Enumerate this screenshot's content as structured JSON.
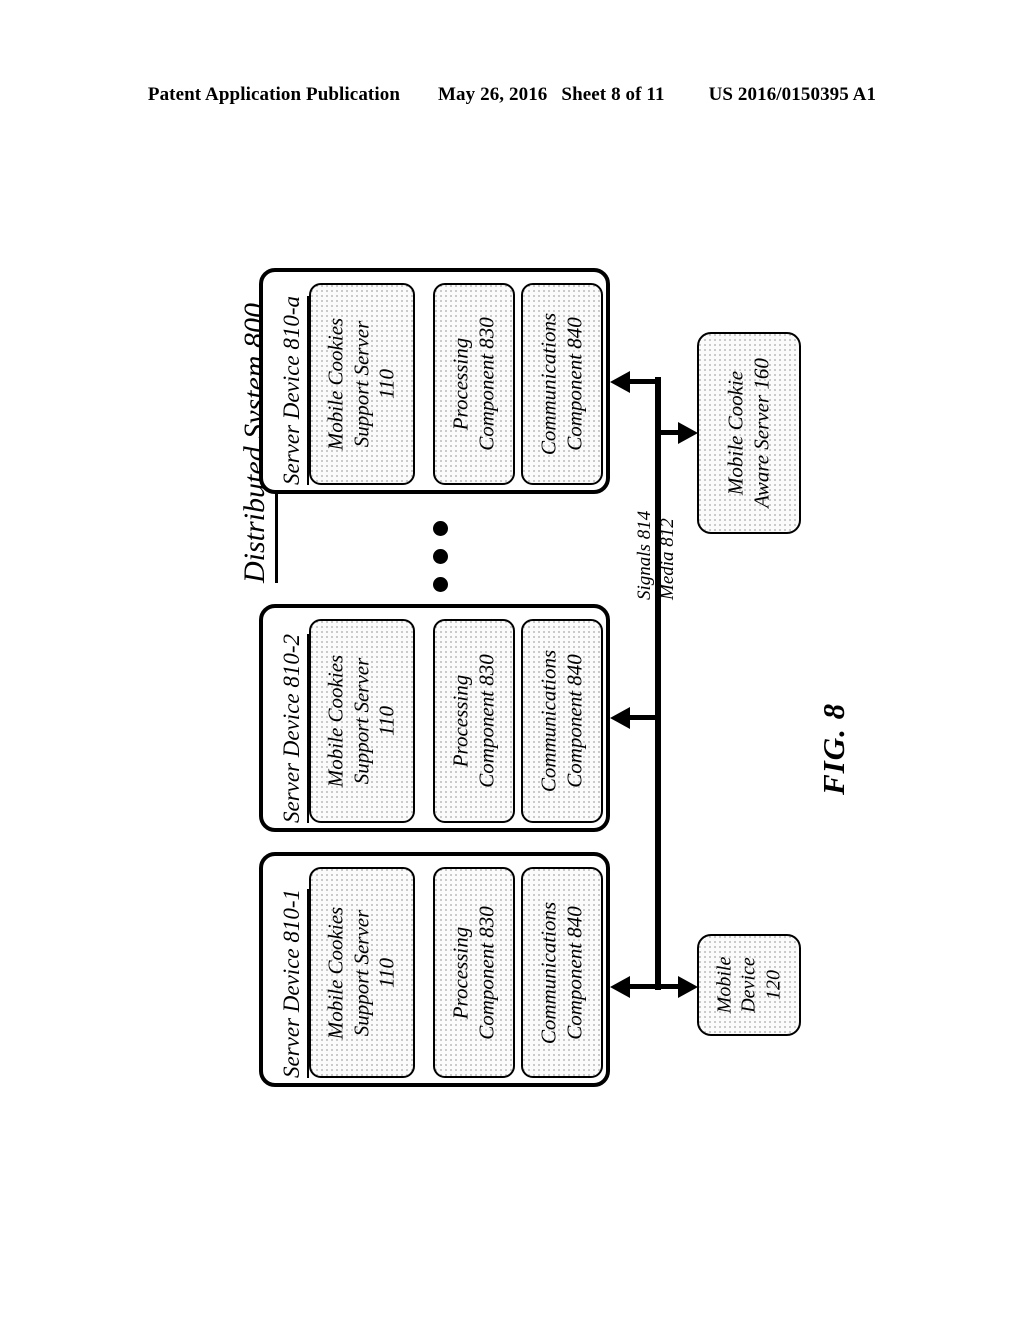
{
  "header": {
    "publication": "Patent Application Publication",
    "date": "May 26, 2016",
    "sheet": "Sheet 8 of 11",
    "patent_number": "US 2016/0150395 A1"
  },
  "figure": {
    "caption": "FIG. 8",
    "system_title": "Distributed System 800"
  },
  "servers": [
    {
      "title": "Server Device 810-a",
      "components": [
        {
          "line1": "Mobile Cookies",
          "line2": "Support Server",
          "line3": "110"
        },
        {
          "line1": "Processing",
          "line2": "Component 830",
          "line3": ""
        },
        {
          "line1": "Communications",
          "line2": "Component 840",
          "line3": ""
        }
      ]
    },
    {
      "title": "Server Device 810-2",
      "components": [
        {
          "line1": "Mobile Cookies",
          "line2": "Support Server",
          "line3": "110"
        },
        {
          "line1": "Processing",
          "line2": "Component 830",
          "line3": ""
        },
        {
          "line1": "Communications",
          "line2": "Component 840",
          "line3": ""
        }
      ]
    },
    {
      "title": "Server Device 810-1",
      "components": [
        {
          "line1": "Mobile Cookies",
          "line2": "Support Server",
          "line3": "110"
        },
        {
          "line1": "Processing",
          "line2": "Component 830",
          "line3": ""
        },
        {
          "line1": "Communications",
          "line2": "Component 840",
          "line3": ""
        }
      ]
    }
  ],
  "external_nodes": {
    "cookie_aware_server": {
      "line1": "Mobile Cookie",
      "line2": "Aware Server 160"
    },
    "mobile_device": {
      "line1": "Mobile",
      "line2": "Device",
      "line3": "120"
    }
  },
  "bus": {
    "signals_label": "Signals 814",
    "media_label": "Media 812"
  },
  "ellipsis": {
    "symbol": "continuation-dots",
    "count": 3
  },
  "colors": {
    "ink": "#000000",
    "paper": "#ffffff",
    "fill_dots": "#b9b9b9",
    "fill_base": "#fbfbfb"
  }
}
